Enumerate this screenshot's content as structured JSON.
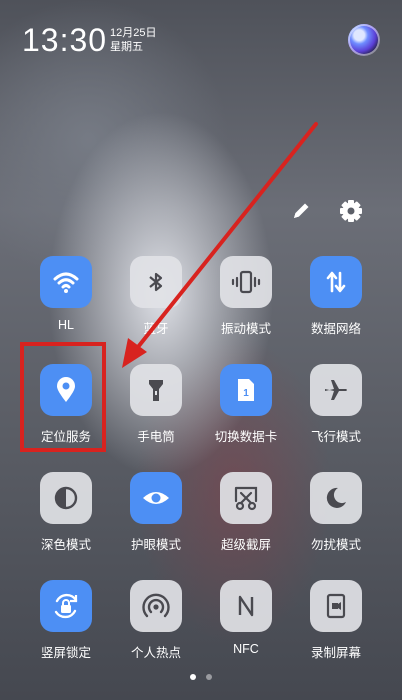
{
  "status": {
    "time": "13:30",
    "date": "12月25日",
    "weekday": "星期五",
    "assistant_icon": "voice-assistant-icon"
  },
  "header_actions": [
    {
      "icon": "edit-icon"
    },
    {
      "icon": "gear-icon"
    }
  ],
  "tiles": [
    {
      "label": "HL",
      "icon": "wifi-icon",
      "state": "on"
    },
    {
      "label": "蓝牙",
      "icon": "bluetooth-icon",
      "state": "off"
    },
    {
      "label": "振动模式",
      "icon": "vibrate-icon",
      "state": "off"
    },
    {
      "label": "数据网络",
      "icon": "mobile-data-icon",
      "state": "on"
    },
    {
      "label": "定位服务",
      "icon": "location-icon",
      "state": "on"
    },
    {
      "label": "手电筒",
      "icon": "flashlight-icon",
      "state": "off"
    },
    {
      "label": "切换数据卡",
      "icon": "sim-card-icon",
      "state": "on"
    },
    {
      "label": "飞行模式",
      "icon": "airplane-icon",
      "state": "off"
    },
    {
      "label": "深色模式",
      "icon": "dark-mode-icon",
      "state": "off"
    },
    {
      "label": "护眼模式",
      "icon": "eye-icon",
      "state": "on"
    },
    {
      "label": "超级截屏",
      "icon": "screenshot-icon",
      "state": "off"
    },
    {
      "label": "勿扰模式",
      "icon": "moon-icon",
      "state": "off"
    },
    {
      "label": "竖屏锁定",
      "icon": "rotation-lock-icon",
      "state": "on"
    },
    {
      "label": "个人热点",
      "icon": "hotspot-icon",
      "state": "off"
    },
    {
      "label": "NFC",
      "icon": "nfc-icon",
      "state": "off"
    },
    {
      "label": "录制屏幕",
      "icon": "screen-record-icon",
      "state": "off"
    }
  ],
  "pager": {
    "pages": 2,
    "current": 1
  },
  "annotation": {
    "color": "#d8231f",
    "highlighted": "定位服务"
  },
  "colors": {
    "accent": "#4d8ff4",
    "tile_off": "#e1e2e6",
    "icon_off": "#4a4a50"
  }
}
